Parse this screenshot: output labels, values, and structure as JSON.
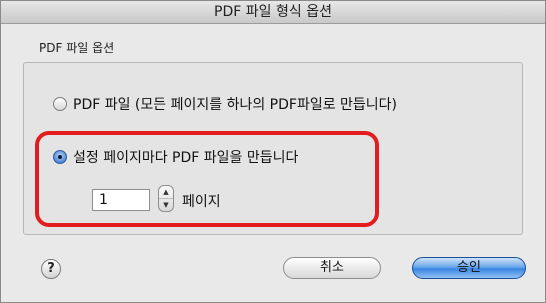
{
  "window": {
    "title": "PDF 파일 형식 옵션"
  },
  "group": {
    "label": "PDF 파일 옵션"
  },
  "options": [
    {
      "label": "PDF 파일 (모든 페이지를 하나의 PDF파일로 만듭니다)",
      "selected": false
    },
    {
      "label": "설정 페이지마다 PDF 파일을 만듭니다",
      "selected": true
    }
  ],
  "pages": {
    "value": "1",
    "unit_label": "페이지"
  },
  "help": {
    "glyph": "?"
  },
  "buttons": {
    "cancel": "취소",
    "ok": "승인"
  },
  "colors": {
    "highlight": "#e11d1d",
    "default_button": "#3a86e2"
  }
}
